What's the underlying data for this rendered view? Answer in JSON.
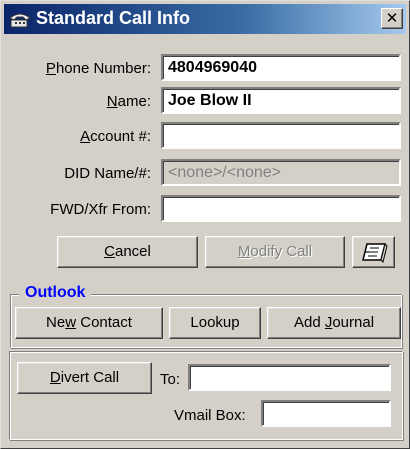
{
  "window": {
    "title": "Standard Call Info",
    "close_label": "✕"
  },
  "fields": {
    "phone_number": {
      "label_pre": "",
      "label_ul": "P",
      "label_post": "hone Number:",
      "value": "4804969040"
    },
    "name": {
      "label_pre": "",
      "label_ul": "N",
      "label_post": "ame:",
      "value": "Joe Blow II"
    },
    "account": {
      "label_pre": "",
      "label_ul": "A",
      "label_post": "ccount #:",
      "value": ""
    },
    "did": {
      "label": "DID Name/#:",
      "value": "<none>/<none>"
    },
    "fwd": {
      "label": "FWD/Xfr From:",
      "value": ""
    }
  },
  "buttons": {
    "cancel": {
      "ul": "C",
      "rest": "ancel"
    },
    "modify_call": {
      "ul": "M",
      "rest": "odify Call"
    },
    "new_contact": {
      "pre": "Ne",
      "ul": "w",
      "post": " Contact"
    },
    "lookup": {
      "label": "Lookup"
    },
    "add_journal": {
      "pre": "Add ",
      "ul": "J",
      "post": "ournal"
    },
    "divert_call": {
      "ul": "D",
      "rest": "ivert Call"
    }
  },
  "outlook": {
    "title": "Outlook"
  },
  "divert": {
    "to_label": "To:",
    "to_value": "",
    "vmail_label": "Vmail Box:",
    "vmail_value": ""
  }
}
